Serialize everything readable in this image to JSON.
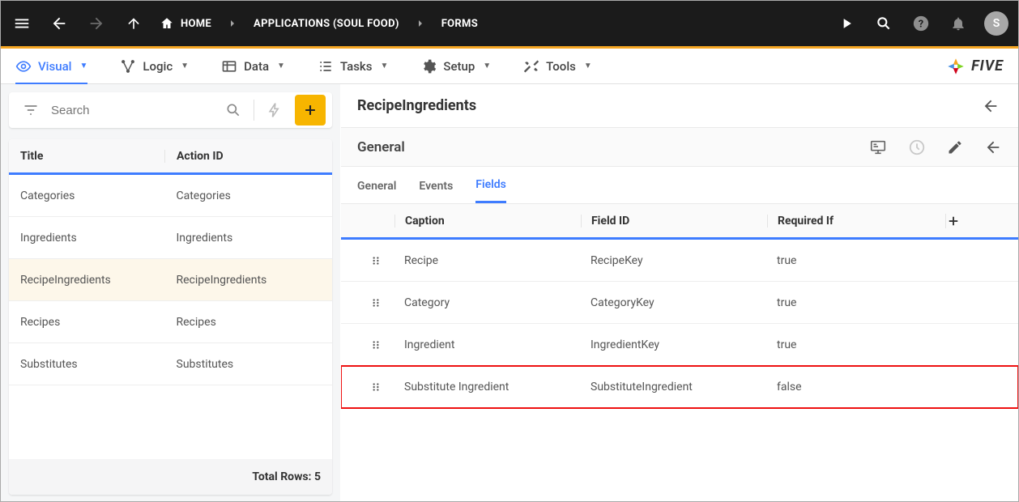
{
  "topbar": {
    "breadcrumbs": [
      {
        "icon": "home",
        "label": "HOME"
      },
      {
        "label": "APPLICATIONS (SOUL FOOD)"
      },
      {
        "label": "FORMS"
      }
    ],
    "avatar": "S"
  },
  "mainTabs": [
    {
      "icon": "eye",
      "label": "Visual",
      "active": true
    },
    {
      "icon": "logic",
      "label": "Logic"
    },
    {
      "icon": "data",
      "label": "Data"
    },
    {
      "icon": "tasks",
      "label": "Tasks"
    },
    {
      "icon": "setup",
      "label": "Setup"
    },
    {
      "icon": "tools",
      "label": "Tools"
    }
  ],
  "brand": "FIVE",
  "leftPanel": {
    "search_placeholder": "Search",
    "columns": {
      "title": "Title",
      "actionId": "Action ID"
    },
    "rows": [
      {
        "title": "Categories",
        "actionId": "Categories"
      },
      {
        "title": "Ingredients",
        "actionId": "Ingredients"
      },
      {
        "title": "RecipeIngredients",
        "actionId": "RecipeIngredients",
        "selected": true
      },
      {
        "title": "Recipes",
        "actionId": "Recipes"
      },
      {
        "title": "Substitutes",
        "actionId": "Substitutes"
      }
    ],
    "footer": "Total Rows: 5"
  },
  "rightPanel": {
    "header_title": "RecipeIngredients",
    "section_title": "General",
    "tabs": [
      {
        "label": "General"
      },
      {
        "label": "Events"
      },
      {
        "label": "Fields",
        "active": true
      }
    ],
    "fieldsTable": {
      "columns": {
        "caption": "Caption",
        "fieldId": "Field ID",
        "requiredIf": "Required If"
      },
      "rows": [
        {
          "caption": "Recipe",
          "fieldId": "RecipeKey",
          "requiredIf": "true"
        },
        {
          "caption": "Category",
          "fieldId": "CategoryKey",
          "requiredIf": "true"
        },
        {
          "caption": "Ingredient",
          "fieldId": "IngredientKey",
          "requiredIf": "true"
        },
        {
          "caption": "Substitute Ingredient",
          "fieldId": "SubstituteIngredient",
          "requiredIf": "false",
          "highlight": true
        }
      ]
    }
  }
}
